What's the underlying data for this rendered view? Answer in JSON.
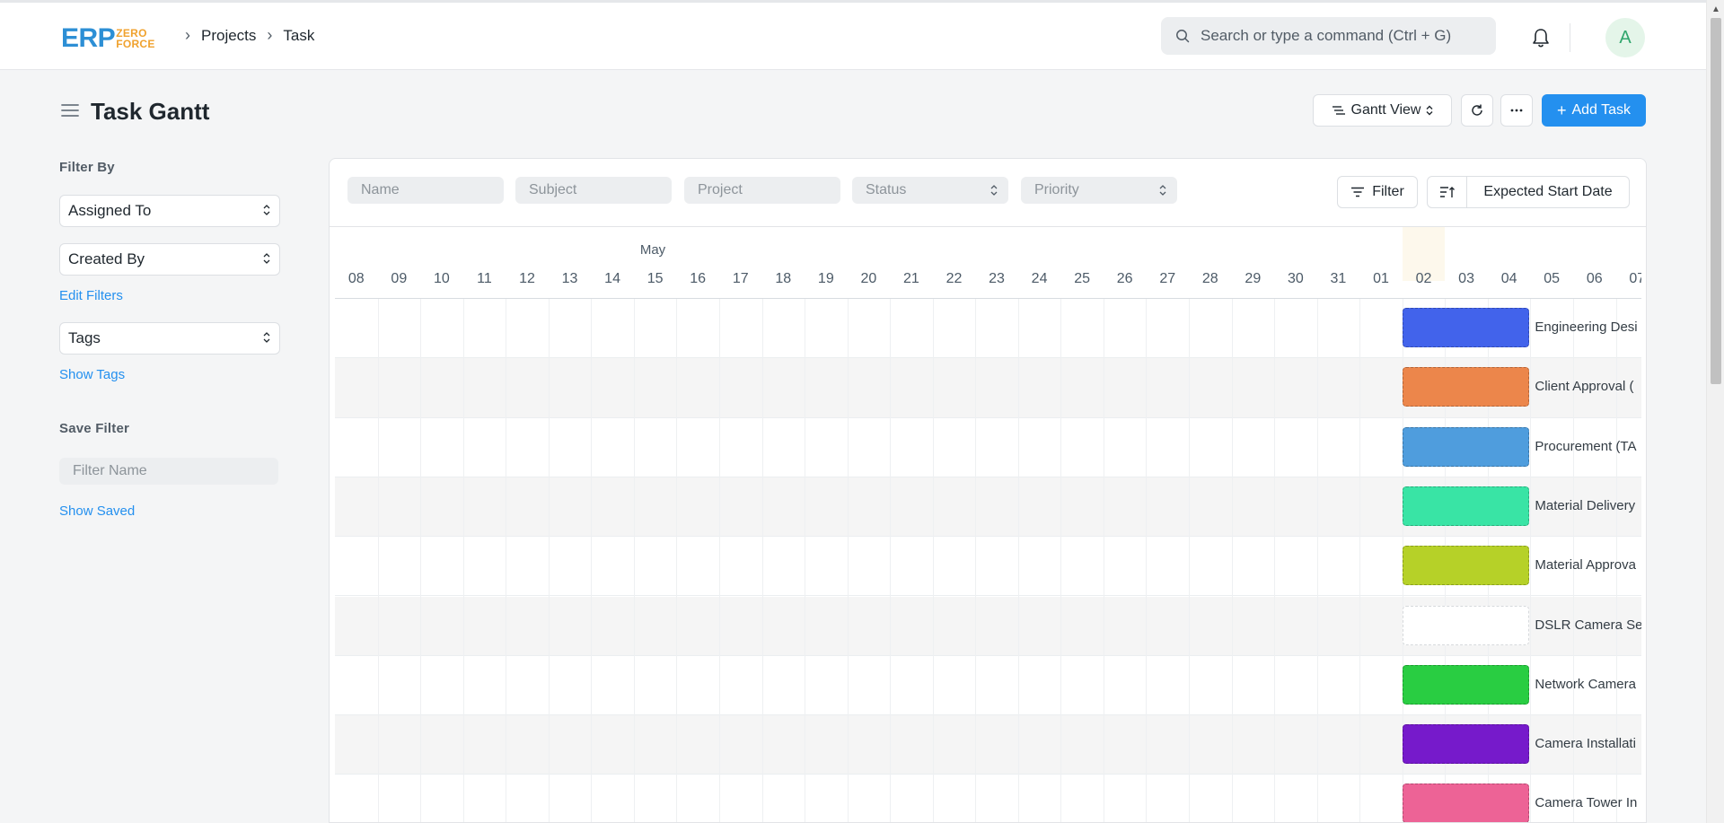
{
  "navbar": {
    "logo_main": "ERP",
    "logo_top": "ZERO",
    "logo_bottom": "FORCE",
    "breadcrumbs": [
      "Projects",
      "Task"
    ],
    "search_placeholder": "Search or type a command (Ctrl + G)",
    "avatar_letter": "A"
  },
  "page": {
    "title": "Task Gantt",
    "view_label": "Gantt View",
    "add_label": "Add Task"
  },
  "sidebar": {
    "filter_by": "Filter By",
    "assigned_to": "Assigned To",
    "created_by": "Created By",
    "edit_filters": "Edit Filters",
    "tags": "Tags",
    "show_tags": "Show Tags",
    "save_filter": "Save Filter",
    "filter_name_placeholder": "Filter Name",
    "show_saved": "Show Saved"
  },
  "filters": {
    "name_placeholder": "Name",
    "subject_placeholder": "Subject",
    "project_placeholder": "Project",
    "status_placeholder": "Status",
    "priority_placeholder": "Priority",
    "filter_label": "Filter",
    "sort_label": "Expected Start Date"
  },
  "gantt": {
    "month": "May",
    "dates": [
      "08",
      "09",
      "10",
      "11",
      "12",
      "13",
      "14",
      "15",
      "16",
      "17",
      "18",
      "19",
      "20",
      "21",
      "22",
      "23",
      "24",
      "25",
      "26",
      "27",
      "28",
      "29",
      "30",
      "31",
      "01",
      "02",
      "03",
      "04",
      "05",
      "06",
      "07"
    ],
    "today_index": 25,
    "tasks": [
      {
        "label": "Engineering Desi",
        "color": "#4263eb",
        "start_index": 25,
        "span_days": 3
      },
      {
        "label": "Client Approval (",
        "color": "#ec864b",
        "start_index": 25,
        "span_days": 3
      },
      {
        "label": "Procurement (TA",
        "color": "#4f9ddd",
        "start_index": 25,
        "span_days": 3
      },
      {
        "label": "Material Delivery",
        "color": "#39e4a5",
        "start_index": 25,
        "span_days": 3
      },
      {
        "label": "Material Approva",
        "color": "#b6d128",
        "start_index": 25,
        "span_days": 3
      },
      {
        "label": "DSLR Camera Se",
        "color": "#ffffff",
        "start_index": 25,
        "span_days": 3
      },
      {
        "label": "Network Camera",
        "color": "#29cd42",
        "start_index": 25,
        "span_days": 3
      },
      {
        "label": "Camera Installati",
        "color": "#761acb",
        "start_index": 25,
        "span_days": 3
      },
      {
        "label": "Camera Tower In",
        "color": "#ed6396",
        "start_index": 25,
        "span_days": 3
      }
    ]
  }
}
